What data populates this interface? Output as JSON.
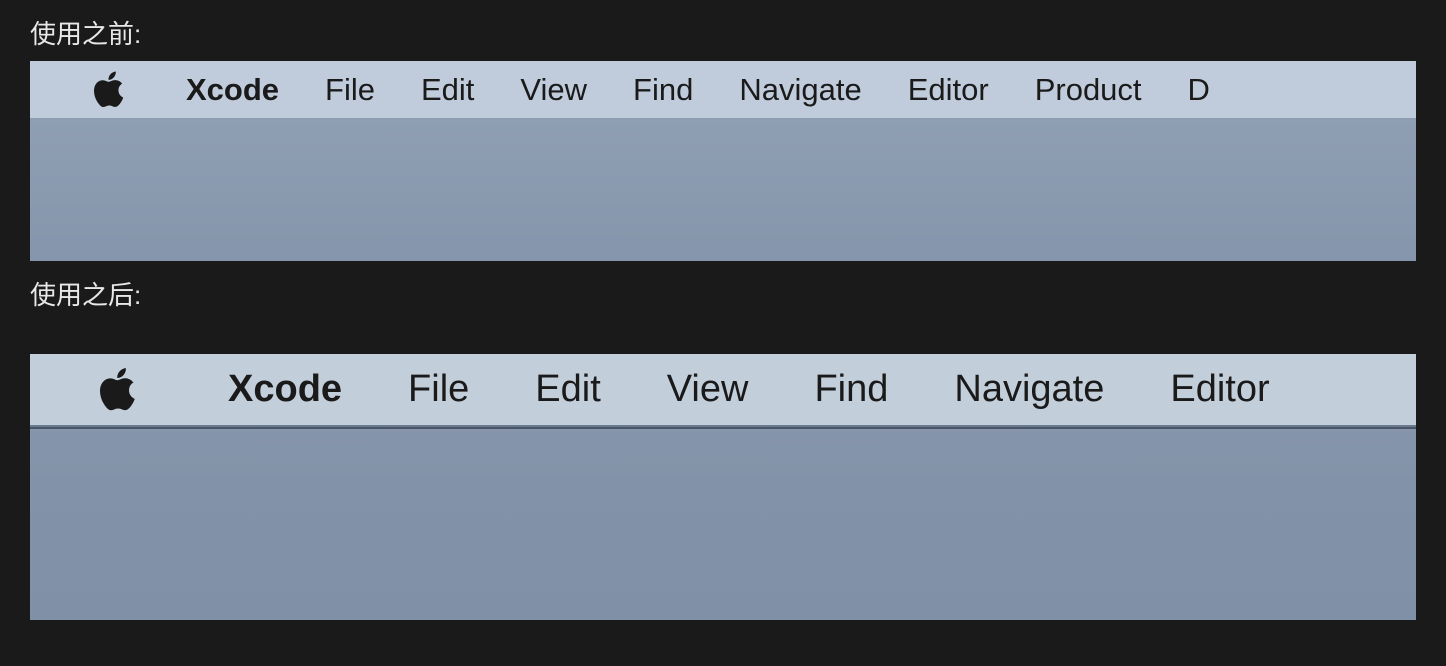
{
  "labels": {
    "before": "使用之前:",
    "after": "使用之后:"
  },
  "menubar_before": {
    "app_name": "Xcode",
    "items": [
      "File",
      "Edit",
      "View",
      "Find",
      "Navigate",
      "Editor",
      "Product"
    ],
    "partial": "D"
  },
  "menubar_after": {
    "app_name": "Xcode",
    "items": [
      "File",
      "Edit",
      "View",
      "Find",
      "Navigate",
      "Editor"
    ]
  }
}
